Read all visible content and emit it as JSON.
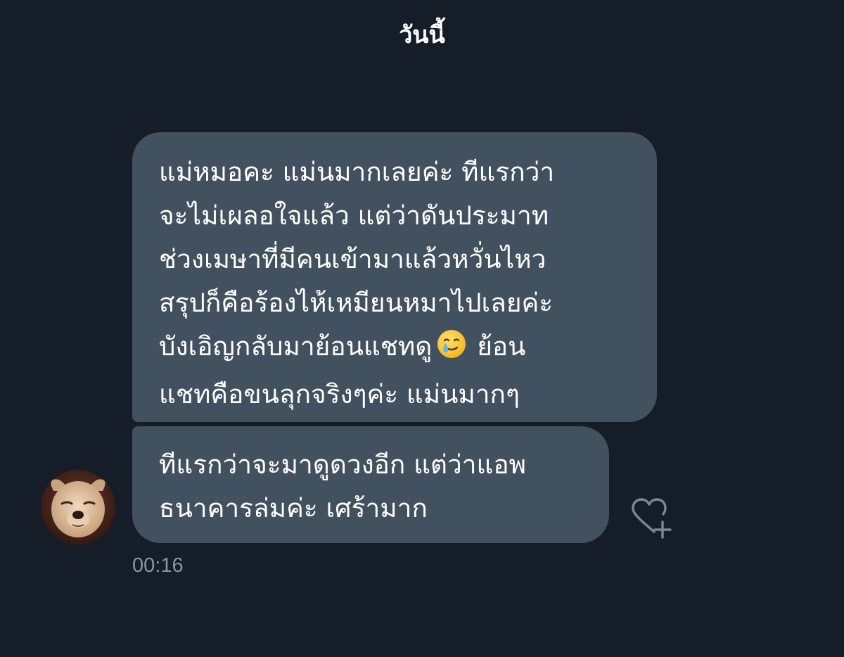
{
  "chat": {
    "day_separator": "วันนี้",
    "messages": [
      {
        "lines": [
          "แม่หมอคะ แม่นมากเลยค่ะ ทีแรกว่า",
          "จะไม่เผลอใจแล้ว แต่ว่าดันประมาท",
          "ช่วงเมษาที่มีคนเข้ามาแล้วหวั่นไหว",
          "สรุปก็คือร้องไห้เหมียนหมาไปเลยค่ะ",
          "บังเอิญกลับมาย้อนแชทดู",
          "ย้อน",
          "แชทคือขนลุกจริงๆค่ะ แม่นมากๆ"
        ],
        "emoji": "face-holding-back-tears-icon"
      },
      {
        "lines": [
          "ทีแรกว่าจะมาดูดวงอีก แต่ว่าแอพ",
          "ธนาคารล่มค่ะ เศร้ามาก"
        ]
      }
    ],
    "timestamp": "00:16",
    "react_icon": "heart-plus-icon",
    "avatar_icon": "dog-avatar"
  },
  "colors": {
    "background": "#151d28",
    "bubble": "#425160",
    "text": "#ffffff",
    "timestamp": "#8b95a1",
    "icon_outline": "#7d8894"
  }
}
